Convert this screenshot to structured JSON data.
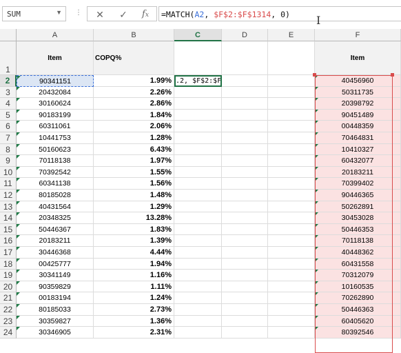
{
  "name_box": {
    "value": "SUM"
  },
  "formula_bar": {
    "cancel_icon": "close-icon",
    "enter_icon": "check-icon",
    "function_icon": "fx-icon",
    "formula_prefix": "=MATCH(",
    "arg1": "A2",
    "sep1": ", ",
    "arg2": "$F$2:$F$1314",
    "sep2": ", 0)"
  },
  "columns": [
    "A",
    "B",
    "C",
    "D",
    "E",
    "F"
  ],
  "rows": [
    "1",
    "2",
    "3",
    "4",
    "5",
    "6",
    "7",
    "8",
    "9",
    "10",
    "11",
    "12",
    "13",
    "14",
    "15",
    "16",
    "17",
    "18",
    "19",
    "20",
    "21",
    "22",
    "23",
    "24"
  ],
  "headers": {
    "a": "Item",
    "b": "COPQ%",
    "f": "Item"
  },
  "edit_cell": {
    "text": ".2, $F$2:$F"
  },
  "data": [
    {
      "item": "90341151",
      "copq": "1.99%",
      "f_item": "40456960"
    },
    {
      "item": "20432084",
      "copq": "2.26%",
      "f_item": "50311735"
    },
    {
      "item": "30160624",
      "copq": "2.86%",
      "f_item": "20398792"
    },
    {
      "item": "90183199",
      "copq": "1.84%",
      "f_item": "90451489"
    },
    {
      "item": "60311061",
      "copq": "2.06%",
      "f_item": "00448359"
    },
    {
      "item": "10441753",
      "copq": "1.28%",
      "f_item": "70464831"
    },
    {
      "item": "50160623",
      "copq": "6.43%",
      "f_item": "10410327"
    },
    {
      "item": "70118138",
      "copq": "1.97%",
      "f_item": "60432077"
    },
    {
      "item": "70392542",
      "copq": "1.55%",
      "f_item": "20183211"
    },
    {
      "item": "60341138",
      "copq": "1.56%",
      "f_item": "70399402"
    },
    {
      "item": "80185028",
      "copq": "1.48%",
      "f_item": "90446365"
    },
    {
      "item": "40431564",
      "copq": "1.29%",
      "f_item": "50262891"
    },
    {
      "item": "20348325",
      "copq": "13.28%",
      "f_item": "30453028"
    },
    {
      "item": "50446367",
      "copq": "1.83%",
      "f_item": "50446353"
    },
    {
      "item": "20183211",
      "copq": "1.39%",
      "f_item": "70118138"
    },
    {
      "item": "30446368",
      "copq": "4.44%",
      "f_item": "40448362"
    },
    {
      "item": "00425777",
      "copq": "1.94%",
      "f_item": "60431558"
    },
    {
      "item": "30341149",
      "copq": "1.16%",
      "f_item": "70312079"
    },
    {
      "item": "90359829",
      "copq": "1.11%",
      "f_item": "10160535"
    },
    {
      "item": "00183194",
      "copq": "1.24%",
      "f_item": "70262890"
    },
    {
      "item": "80185033",
      "copq": "2.73%",
      "f_item": "50446363"
    },
    {
      "item": "30359827",
      "copq": "1.36%",
      "f_item": "60405620"
    },
    {
      "item": "30346905",
      "copq": "2.31%",
      "f_item": "80392546"
    }
  ],
  "colors": {
    "accent": "#217346",
    "range_blue": "#3a6fd8",
    "range_red": "#d94c4c"
  }
}
